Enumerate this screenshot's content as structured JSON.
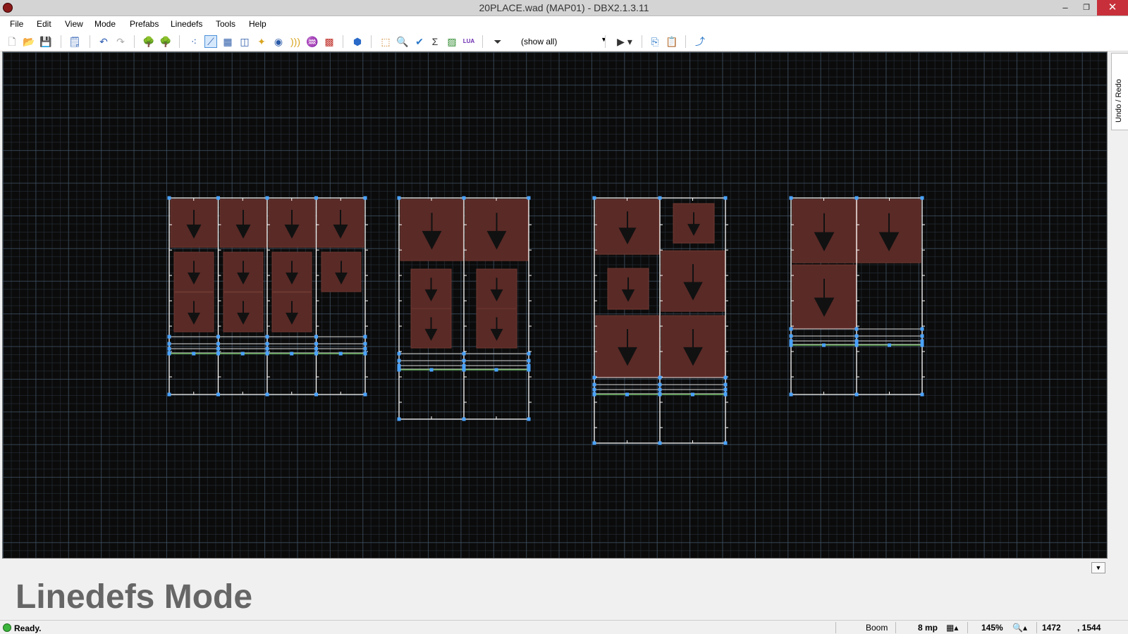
{
  "window": {
    "title": "20PLACE.wad (MAP01) - DBX2.1.3.11",
    "minimize": "–",
    "maximize": "❐",
    "close": "✕"
  },
  "menu": [
    "File",
    "Edit",
    "View",
    "Mode",
    "Prefabs",
    "Linedefs",
    "Tools",
    "Help"
  ],
  "toolbar": {
    "filter_value": "(show all)",
    "filter_arrow": "▼",
    "play": "▶ ▾"
  },
  "side_dock": {
    "tab": "Undo / Redo"
  },
  "expand_button": "▼",
  "mode_label": "Linedefs Mode",
  "status": {
    "text": "Ready.",
    "game": "Boom",
    "grid": "8 mp",
    "zoom": "145%",
    "coord_x": "1472",
    "coord_y": ", 1544"
  },
  "colors": {
    "accent": "#4a90d9",
    "sector_fill": "#5a2a26",
    "vertex": "#4aa3ff",
    "tag_line": "#5ab04a"
  },
  "map_groups": 4
}
